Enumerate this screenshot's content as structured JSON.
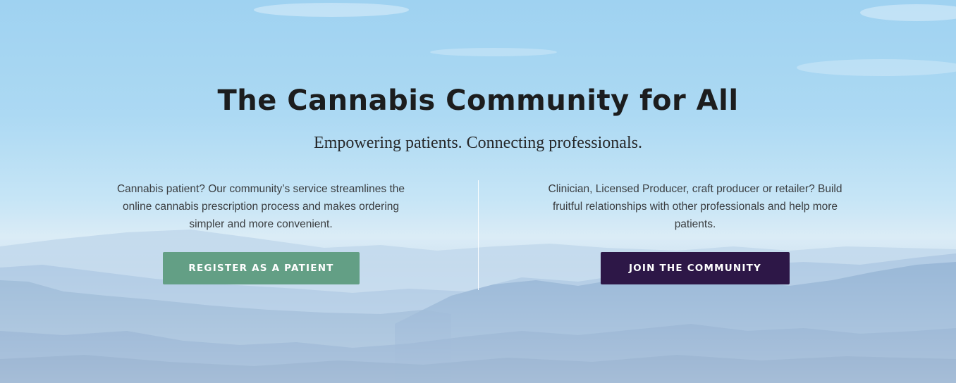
{
  "hero": {
    "title": "The Cannabis Community for All",
    "subtitle": "Empowering patients. Connecting professionals.",
    "patient": {
      "description": "Cannabis patient? Our community’s service streamlines the online cannabis prescription process and makes ordering simpler and more convenient.",
      "button_label": "REGISTER AS A PATIENT"
    },
    "professional": {
      "description": "Clinician, Licensed Producer, craft producer or retailer? Build fruitful relationships with other professionals and help more patients.",
      "button_label": "JOIN THE COMMUNITY"
    }
  },
  "colors": {
    "patient_button": "#639f85",
    "community_button": "#2d1747",
    "title_text": "#1c1d1e",
    "body_text": "#3a3d40"
  }
}
